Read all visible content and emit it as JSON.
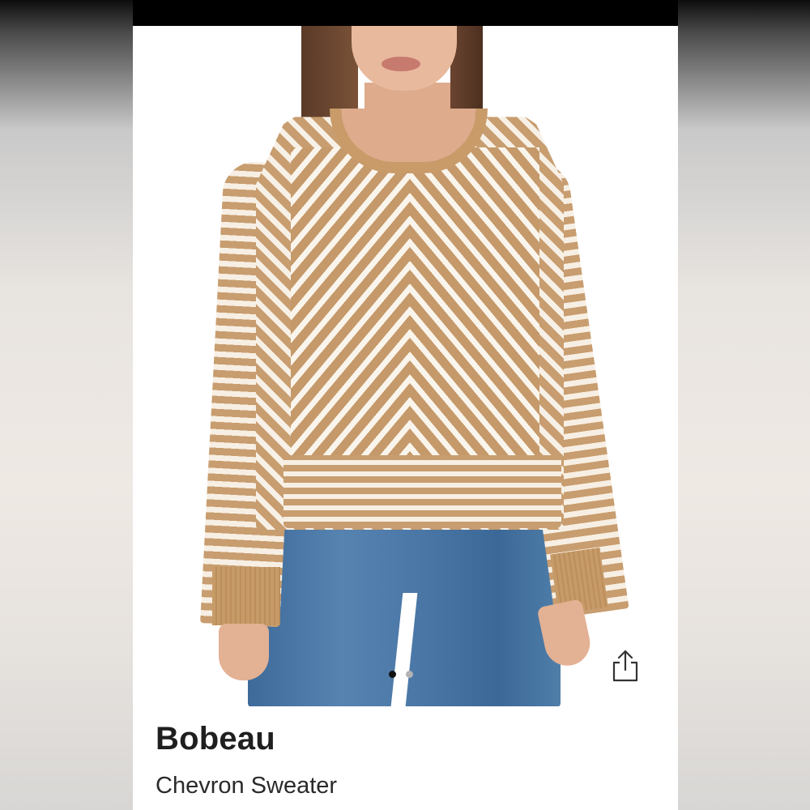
{
  "product": {
    "brand": "Bobeau",
    "name": "Chevron Sweater"
  },
  "gallery": {
    "image_count": 2,
    "active_index": 0
  },
  "icons": {
    "share": "share-icon"
  },
  "colors": {
    "camel": "#c89d6f",
    "cream": "#f7f0e6",
    "denim": "#4a77a6",
    "dot_active": "#111111",
    "dot_inactive": "#b3b3b3"
  }
}
